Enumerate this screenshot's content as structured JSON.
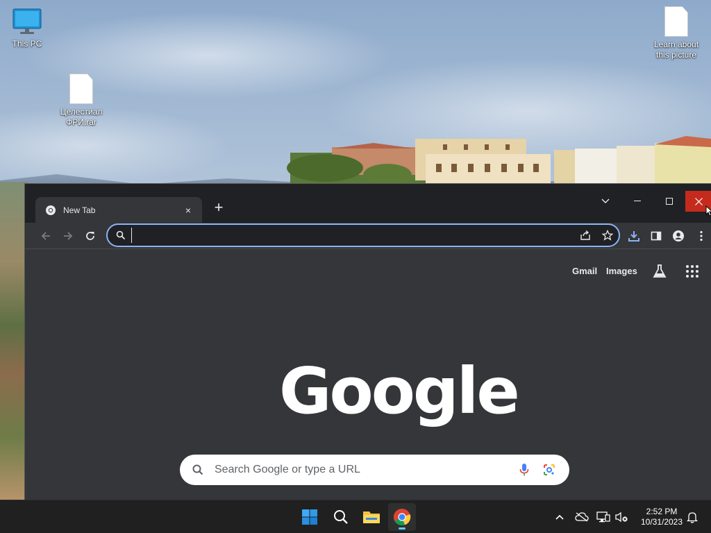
{
  "desktop": {
    "icons": [
      {
        "label": "This PC",
        "icon": "monitor-icon"
      },
      {
        "label": "Целестиал\nФРИ.rar",
        "icon": "file-icon"
      },
      {
        "label": "Learn about\nthis picture",
        "icon": "file-icon"
      }
    ]
  },
  "browser": {
    "tab": {
      "title": "New Tab",
      "close_label": "×"
    },
    "new_tab_label": "+",
    "omnibox": {
      "value": "",
      "placeholder": ""
    },
    "top_links": {
      "gmail": "Gmail",
      "images": "Images"
    },
    "logo_text": "Google",
    "search": {
      "placeholder": "Search Google or type a URL"
    },
    "colors": {
      "titlebar": "#202124",
      "surface": "#35363a",
      "omnibox_focus": "#8ab4f8",
      "close_hover": "#c42b1c"
    }
  },
  "taskbar": {
    "apps": [
      "windows-start-icon",
      "search-icon",
      "file-explorer-icon",
      "chrome-icon"
    ],
    "clock": {
      "time": "2:52 PM",
      "date": "10/31/2023"
    }
  }
}
